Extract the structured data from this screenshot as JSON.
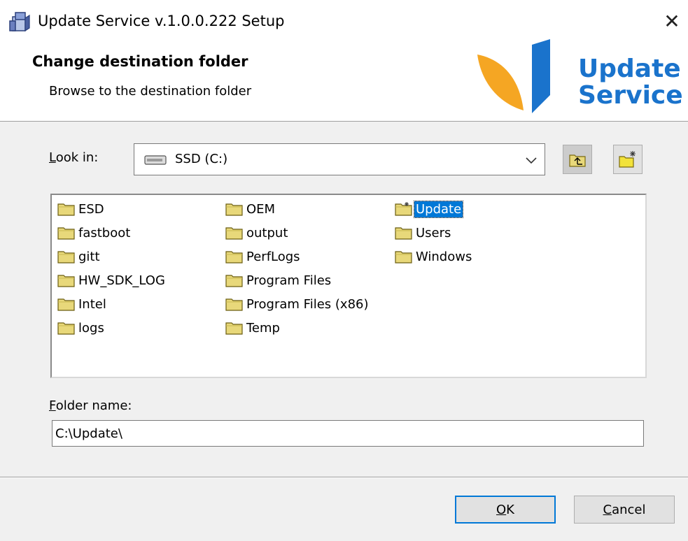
{
  "window": {
    "title": "Update Service v.1.0.0.222 Setup",
    "close_symbol": "✕"
  },
  "banner": {
    "title": "Change destination folder",
    "subtitle": "Browse to the destination folder",
    "logo_line1": "Update",
    "logo_line2": "Service",
    "brand_blue": "#1a73cc",
    "brand_orange": "#f5a623"
  },
  "lookin": {
    "label_accel": "L",
    "label_rest": "ook in:",
    "value": "SSD (C:)",
    "drive_icon": "drive-icon",
    "arrow_icon": "chevron-down-icon"
  },
  "toolbar": {
    "up_icon": "folder-up-icon",
    "new_icon": "new-folder-icon"
  },
  "folders": {
    "col1": [
      "ESD",
      "fastboot",
      "gitt",
      "HW_SDK_LOG",
      "Intel",
      "logs"
    ],
    "col2": [
      "OEM",
      "output",
      "PerfLogs",
      "Program Files",
      "Program Files (x86)",
      "Temp"
    ],
    "col3": [
      "Update",
      "Users",
      "Windows"
    ],
    "selected": "Update"
  },
  "folder_name": {
    "label_accel": "F",
    "label_rest": "older name:",
    "value": "C:\\Update\\"
  },
  "buttons": {
    "ok_accel": "O",
    "ok_rest": "K",
    "cancel_accel": "C",
    "cancel_rest": "ancel"
  },
  "colors": {
    "selection": "#0078d7",
    "folder": "#e8d87a"
  }
}
